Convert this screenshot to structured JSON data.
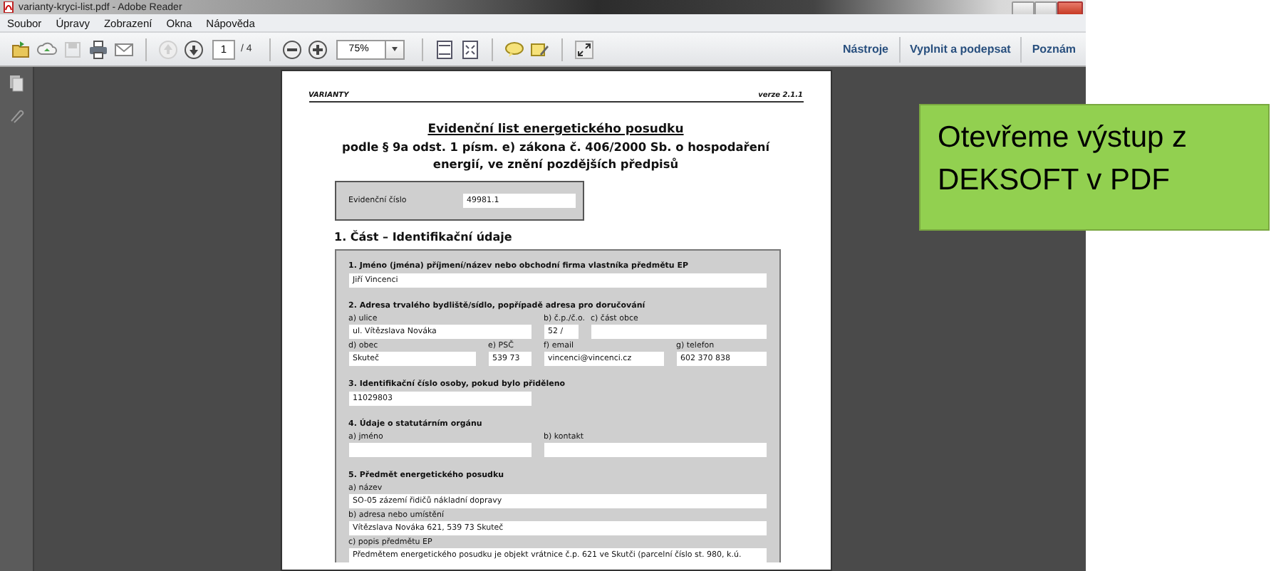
{
  "window": {
    "title": "varianty-kryci-list.pdf - Adobe Reader"
  },
  "menu": [
    "Soubor",
    "Úpravy",
    "Zobrazení",
    "Okna",
    "Nápověda"
  ],
  "toolbar": {
    "save_disabled": true,
    "previous_page_disabled": true,
    "page": "1",
    "page_count": "/ 4",
    "zoom": "75%"
  },
  "panel_tabs": [
    "Nástroje",
    "Vyplnit a podepsat",
    "Poznám"
  ],
  "document": {
    "header_left": "VARIANTY",
    "header_right": "verze 2.1.1",
    "title": "Evidenční list energetického posudku",
    "subtitle": "podle § 9a odst. 1 písm. e) zákona č. 406/2000 Sb. o hospodaření energií, ve znění pozdějších předpisů",
    "record": {
      "label": "Evidenční číslo",
      "value": "49981.1"
    },
    "part": "1. Část – Identifikační údaje",
    "sections": [
      {
        "heading": "1. Jméno (jména) příjmení/název nebo obchodní firma vlastníka předmětu EP",
        "lines": [
          {
            "fields": [
              {
                "value": "Jiří Vincenci",
                "kind": "full"
              }
            ]
          }
        ]
      },
      {
        "heading": "2. Adresa trvalého bydliště/sídlo, popřípadě adresa pro doručování",
        "lines": [
          {
            "fields": [
              {
                "label": "a) ulice",
                "value": "ul. Vítězslava Nováka"
              },
              {
                "label": "b) č.p./č.o.",
                "value": "52 /"
              },
              {
                "label": "c) část obce"
              }
            ]
          },
          {
            "fields": [
              {
                "label": "d) obec",
                "value": "Skuteč"
              },
              {
                "label": "e) PSČ",
                "value": "539 73"
              },
              {
                "label": "f) email",
                "value": "vincenci@vincenci.cz"
              },
              {
                "label": "g) telefon",
                "value": "602 370 838"
              }
            ]
          }
        ]
      },
      {
        "heading": "3. Identifikační číslo osoby, pokud bylo přiděleno",
        "lines": [
          {
            "fields": [
              {
                "value": "11029803",
                "kind": "short"
              }
            ]
          }
        ]
      },
      {
        "heading": "4. Údaje o statutárním orgánu",
        "lines": [
          {
            "fields": [
              {
                "label": "a) jméno"
              },
              {
                "label": "b) kontakt"
              }
            ]
          }
        ]
      },
      {
        "heading": "5. Předmět energetického posudku",
        "lines": [
          {
            "fields": [
              {
                "label": "a) název",
                "value": "SO-05 zázemí řidičů nákladní dopravy",
                "kind": "full"
              }
            ]
          },
          {
            "fields": [
              {
                "label": "b) adresa nebo umístění",
                "value": "Vítězslava Nováka 621, 539 73 Skuteč",
                "kind": "full"
              }
            ]
          },
          {
            "fields": [
              {
                "label": "c) popis předmětu EP",
                "value": "Předmětem energetického posudku je objekt  vrátnice č.p. 621 ve Skutči (parcelní číslo st. 980, k.ú.",
                "kind": "full"
              }
            ]
          }
        ]
      }
    ]
  },
  "callout": {
    "text": "Otevřeme výstup z DEKSOFT v PDF"
  }
}
